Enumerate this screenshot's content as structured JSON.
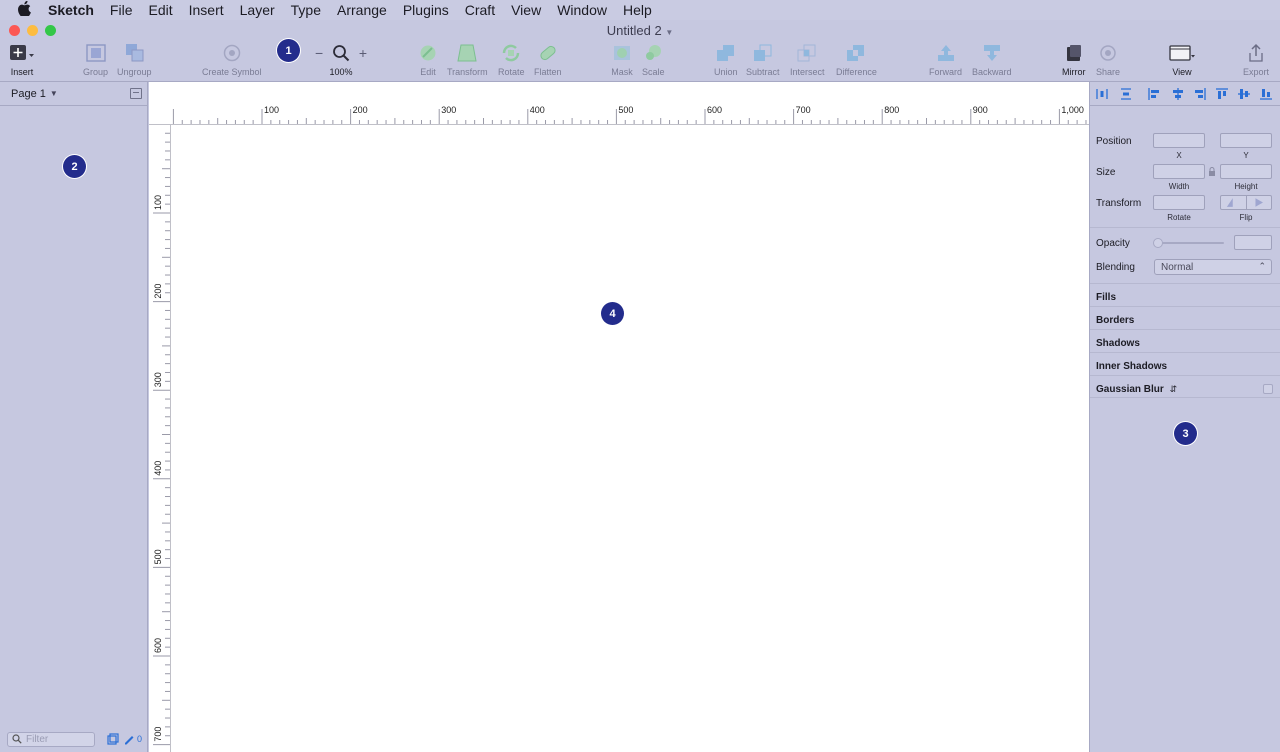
{
  "menubar": {
    "app_name": "Sketch",
    "items": [
      "File",
      "Edit",
      "Insert",
      "Layer",
      "Type",
      "Arrange",
      "Plugins",
      "Craft",
      "View",
      "Window",
      "Help"
    ]
  },
  "window": {
    "title": "Untitled 2",
    "traffic_colors": [
      "#fc5753",
      "#fdbc40",
      "#33c748"
    ]
  },
  "toolbar": {
    "insert": "Insert",
    "group": "Group",
    "ungroup": "Ungroup",
    "create_symbol": "Create Symbol",
    "zoom_minus": "−",
    "zoom_plus": "+",
    "zoom_level": "100%",
    "edit": "Edit",
    "transform": "Transform",
    "rotate": "Rotate",
    "flatten": "Flatten",
    "mask": "Mask",
    "scale": "Scale",
    "union": "Union",
    "subtract": "Subtract",
    "intersect": "Intersect",
    "difference": "Difference",
    "forward": "Forward",
    "backward": "Backward",
    "mirror": "Mirror",
    "share": "Share",
    "view": "View",
    "export": "Export"
  },
  "sidebar": {
    "page_selector": "Page 1",
    "filter_placeholder": "Filter",
    "slice_count": "0"
  },
  "rulers": {
    "horizontal": [
      "100",
      "200",
      "300",
      "400",
      "500",
      "600",
      "700",
      "800",
      "900",
      "1,000"
    ],
    "vertical": [
      "100",
      "200",
      "300",
      "400",
      "500",
      "600",
      "700"
    ]
  },
  "inspector": {
    "position_label": "Position",
    "x_label": "X",
    "y_label": "Y",
    "size_label": "Size",
    "width_label": "Width",
    "height_label": "Height",
    "transform_label": "Transform",
    "rotate_label": "Rotate",
    "flip_label": "Flip",
    "opacity_label": "Opacity",
    "blending_label": "Blending",
    "blending_value": "Normal",
    "sections": [
      "Fills",
      "Borders",
      "Shadows",
      "Inner Shadows",
      "Gaussian Blur"
    ]
  },
  "badges": [
    "1",
    "2",
    "3",
    "4"
  ],
  "colors": {
    "chrome": "#c6c8e0",
    "badge": "#232c8c",
    "accent": "#2a6fd6"
  }
}
